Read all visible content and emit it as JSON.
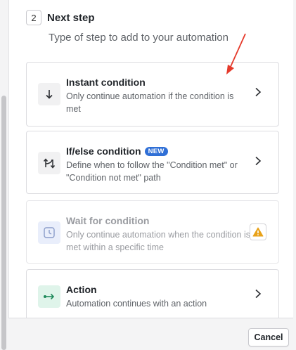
{
  "header": {
    "step_number": "2",
    "title": "Next step",
    "subtitle": "Type of step to add to your automation"
  },
  "options": [
    {
      "title": "Instant condition",
      "description": "Only continue automation if the condition is met",
      "icon": "arrow-down-icon"
    },
    {
      "title": "If/else condition",
      "badge": "NEW",
      "description": "Define when to follow the \"Condition met\" or \"Condition not met\" path",
      "icon": "branch-icon"
    },
    {
      "title": "Wait for condition",
      "description": "Only continue automation when the condition is met within a specific time",
      "icon": "clock-icon",
      "disabled": true,
      "status_icon": "warning-icon"
    },
    {
      "title": "Action",
      "description": "Automation continues with an action",
      "icon": "arrow-right-icon"
    }
  ],
  "footer": {
    "cancel_label": "Cancel"
  },
  "colors": {
    "new_badge": "#2f6fd6",
    "warning": "#e8a21a",
    "action_icon_bg": "#dff4ea",
    "action_icon": "#1f8a5b",
    "annotation_arrow": "#e53a2b"
  }
}
